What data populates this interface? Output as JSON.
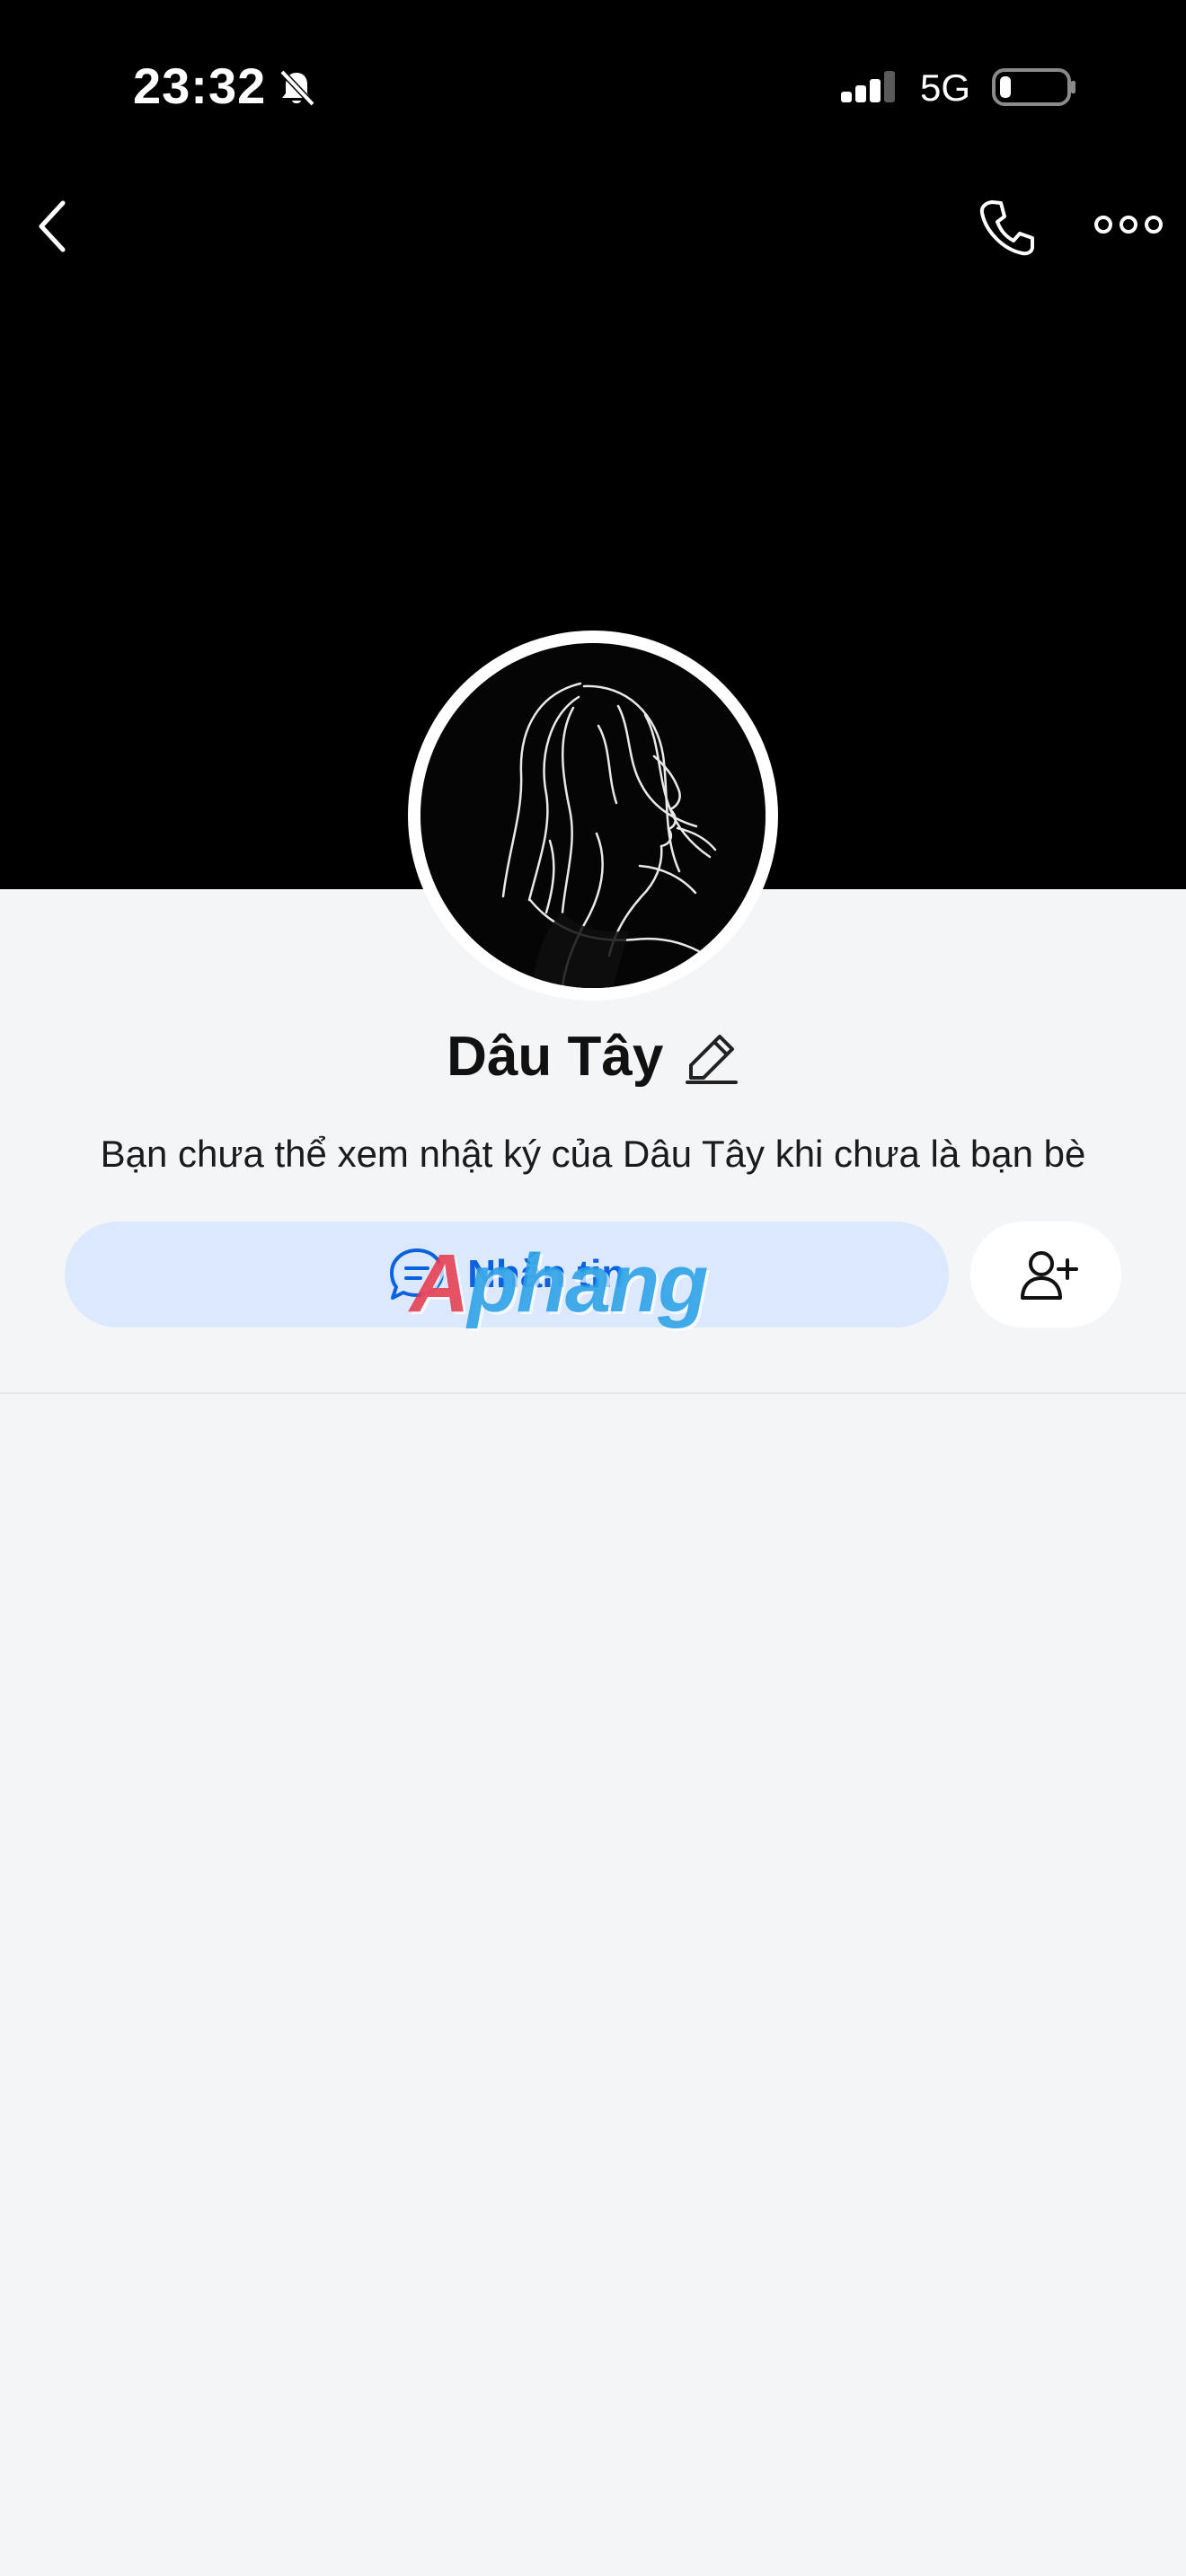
{
  "status_bar": {
    "time": "23:32",
    "network": "5G",
    "icons": [
      "bell-off-icon",
      "signal-icon",
      "battery-icon"
    ]
  },
  "header": {
    "icons": [
      "back-icon",
      "phone-icon",
      "more-icon"
    ]
  },
  "profile": {
    "name": "Dâu Tây",
    "privacy_note": "Bạn chưa thể xem nhật ký của Dâu Tây khi chưa là bạn bè"
  },
  "actions": {
    "message_label": "Nhắn tin",
    "message_icon": "chat-bubble-icon",
    "add_friend_icon": "add-friend-icon"
  },
  "watermark": {
    "first_letter": "A",
    "rest": "phang"
  },
  "colors": {
    "header_background": "#000000",
    "page_background": "#f3f5f7",
    "message_button_background": "#dbe8fd",
    "message_text": "#0b62df",
    "watermark_red": "#e5394f",
    "watermark_blue": "#289fe6"
  }
}
